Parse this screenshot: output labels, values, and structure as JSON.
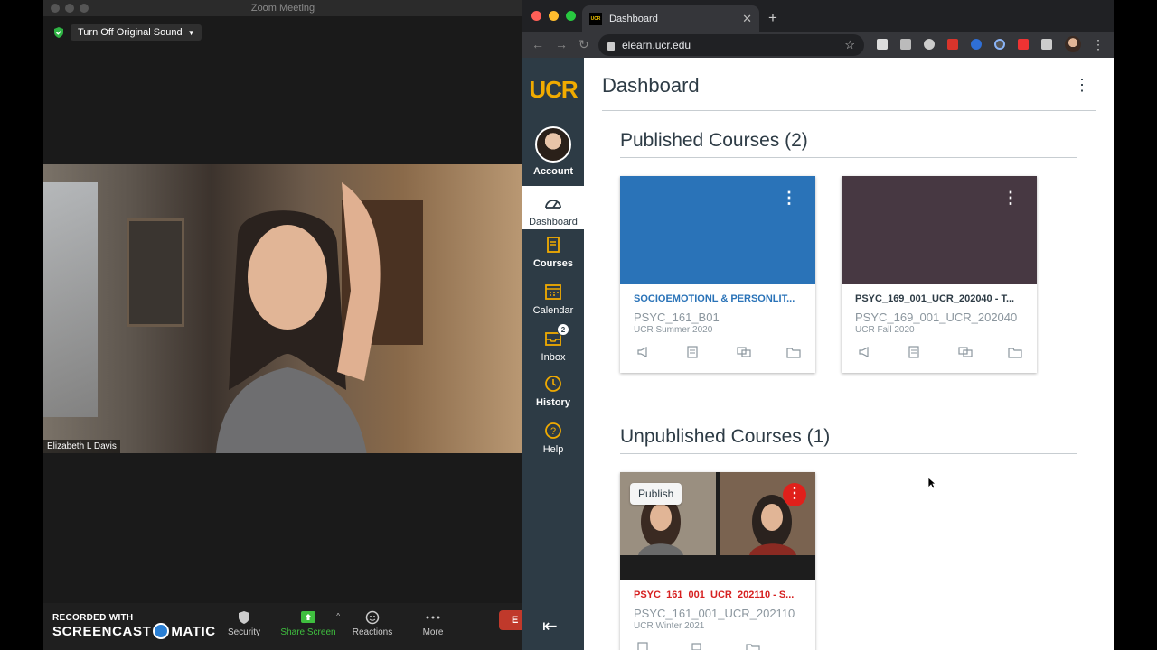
{
  "zoom": {
    "window_title": "Zoom Meeting",
    "original_sound_label": "Turn Off Original Sound",
    "participant_name": "Elizabeth L Davis",
    "controls": {
      "security": "Security",
      "share_screen": "Share Screen",
      "reactions": "Reactions",
      "more": "More",
      "end": "E"
    },
    "watermark": {
      "recorded_with": "RECORDED WITH",
      "brand_left": "SCREENCAST",
      "brand_right": "MATIC"
    }
  },
  "browser": {
    "tab_title": "Dashboard",
    "favicon_text": "UCR",
    "url": "elearn.ucr.edu"
  },
  "canvas": {
    "logo": "UCR",
    "nav": {
      "account": "Account",
      "dashboard": "Dashboard",
      "courses": "Courses",
      "calendar": "Calendar",
      "inbox": "Inbox",
      "inbox_badge": "2",
      "history": "History",
      "help": "Help"
    },
    "page_title": "Dashboard",
    "published_title": "Published Courses (2)",
    "unpublished_title": "Unpublished Courses (1)",
    "publish_label": "Publish",
    "courses": [
      {
        "title": "SOCIOEMOTIONL & PERSONLIT...",
        "code": "PSYC_161_B01",
        "term": "UCR Summer 2020",
        "color": "#2a73b8",
        "title_color": "#2a73b8"
      },
      {
        "title": "PSYC_169_001_UCR_202040 - T...",
        "code": "PSYC_169_001_UCR_202040",
        "term": "UCR Fall 2020",
        "color": "#473842",
        "title_color": "#2d3b45"
      },
      {
        "title": "PSYC_161_001_UCR_202110 - S...",
        "code": "PSYC_161_001_UCR_202110",
        "term": "UCR Winter 2021",
        "color": "#e0201b",
        "title_color": "#d62020"
      }
    ]
  }
}
